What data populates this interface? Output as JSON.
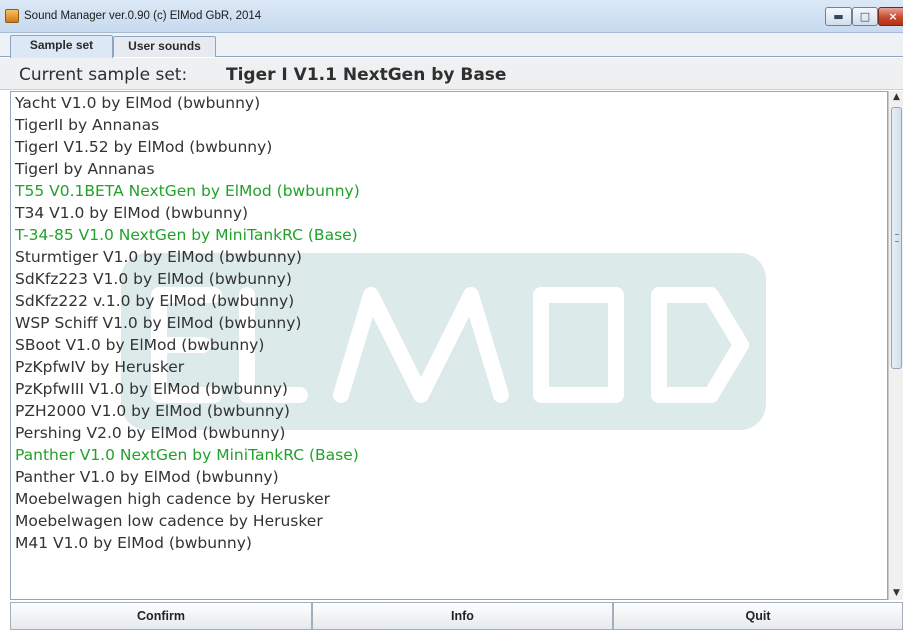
{
  "window": {
    "title": "Sound Manager ver.0.90 (c) ElMod GbR, 2014",
    "buttons": {
      "minimize": "▬",
      "maximize": "□",
      "close": "×"
    }
  },
  "tabs": [
    {
      "label": "Sample set",
      "selected": true
    },
    {
      "label": "User sounds",
      "selected": false
    }
  ],
  "header": {
    "label": "Current sample set:",
    "value": "Tiger I V1.1 NextGen by Base"
  },
  "list": {
    "items": [
      {
        "label": "Yacht V1.0 by ElMod (bwbunny)",
        "color": "#333333"
      },
      {
        "label": "TigerII  by Annanas",
        "color": "#333333"
      },
      {
        "label": "TigerI V1.52 by ElMod (bwbunny)",
        "color": "#333333"
      },
      {
        "label": "TigerI  by Annanas",
        "color": "#333333"
      },
      {
        "label": "T55 V0.1BETA NextGen by ElMod (bwbunny)",
        "color": "#22a12b"
      },
      {
        "label": "T34 V1.0 by ElMod (bwbunny)",
        "color": "#333333"
      },
      {
        "label": "T-34-85 V1.0 NextGen by MiniTankRC (Base)",
        "color": "#22a12b"
      },
      {
        "label": "Sturmtiger V1.0 by ElMod (bwbunny)",
        "color": "#333333"
      },
      {
        "label": "SdKfz223 V1.0 by ElMod (bwbunny)",
        "color": "#333333"
      },
      {
        "label": "SdKfz222 v.1.0 by ElMod (bwbunny)",
        "color": "#333333"
      },
      {
        "label": "WSP Schiff V1.0 by ElMod (bwbunny)",
        "color": "#333333"
      },
      {
        "label": "SBoot V1.0 by ElMod (bwbunny)",
        "color": "#333333"
      },
      {
        "label": "PzKpfwIV  by Herusker",
        "color": "#333333"
      },
      {
        "label": "PzKpfwIII V1.0 by ElMod (bwbunny)",
        "color": "#333333"
      },
      {
        "label": "PZH2000 V1.0 by ElMod (bwbunny)",
        "color": "#333333"
      },
      {
        "label": "Pershing V2.0 by ElMod (bwbunny)",
        "color": "#333333"
      },
      {
        "label": "Panther V1.0 NextGen by MiniTankRC (Base)",
        "color": "#22a12b"
      },
      {
        "label": "Panther V1.0 by ElMod (bwbunny)",
        "color": "#333333"
      },
      {
        "label": "Moebelwagen high cadence by Herusker",
        "color": "#333333"
      },
      {
        "label": "Moebelwagen low cadence by Herusker",
        "color": "#333333"
      },
      {
        "label": "M41 V1.0 by ElMod (bwbunny)",
        "color": "#333333"
      }
    ],
    "watermark": "ELMOD"
  },
  "actions": {
    "confirm": "Confirm",
    "info": "Info",
    "quit": "Quit"
  },
  "scrollbar": {
    "up_icon": "▲",
    "down_icon": "▼"
  },
  "icons": {
    "app": "java-icon",
    "scroll_up": "scroll-up-arrow-icon",
    "scroll_down": "scroll-down-arrow-icon"
  }
}
